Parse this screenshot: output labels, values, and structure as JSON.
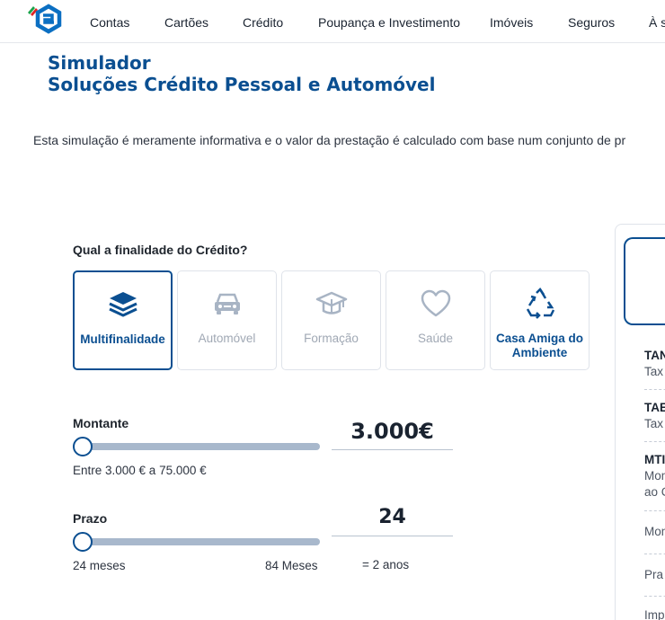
{
  "nav": {
    "items": [
      "Contas",
      "Cartões",
      "Crédito",
      "Poupança e Investimento",
      "Imóveis",
      "Seguros",
      "À s"
    ]
  },
  "title": {
    "line1": "Simulador",
    "line2": "Soluções Crédito Pessoal e Automóvel"
  },
  "intro": "Esta simulação é meramente informativa e o valor da prestação é calculado com base num conjunto de pr",
  "finality": {
    "question": "Qual a finalidade do Crédito?",
    "options": [
      {
        "label": "Multifinalidade",
        "icon": "layers-icon",
        "selected": true
      },
      {
        "label": "Automóvel",
        "icon": "car-icon",
        "selected": false
      },
      {
        "label": "Formação",
        "icon": "graduation-cap-icon",
        "selected": false
      },
      {
        "label": "Saúde",
        "icon": "heart-icon",
        "selected": false
      },
      {
        "label": "Casa Amiga do Ambiente",
        "icon": "recycle-icon",
        "selected": false
      }
    ]
  },
  "montante": {
    "label": "Montante",
    "value": "3.000€",
    "range": "Entre 3.000 € a 75.000 €",
    "slider_fraction": 0
  },
  "prazo": {
    "label": "Prazo",
    "value": "24",
    "min_label": "24 meses",
    "max_label": "84 Meses",
    "equivalent": "= 2 anos",
    "slider_fraction": 0
  },
  "results": {
    "items": [
      {
        "title": "TAN",
        "sub": "Tax"
      },
      {
        "title": "TAE",
        "sub": "Tax"
      },
      {
        "title": "MTI",
        "sub": "Mon",
        "sub2": "ao C"
      },
      {
        "title": "",
        "sub": "Mon"
      },
      {
        "title": "",
        "sub": "Pra"
      },
      {
        "title": "",
        "sub": "Imp"
      }
    ]
  },
  "colors": {
    "brand": "#0b4f91",
    "inactive": "#a0a8b4",
    "track": "#a8b8cc"
  }
}
